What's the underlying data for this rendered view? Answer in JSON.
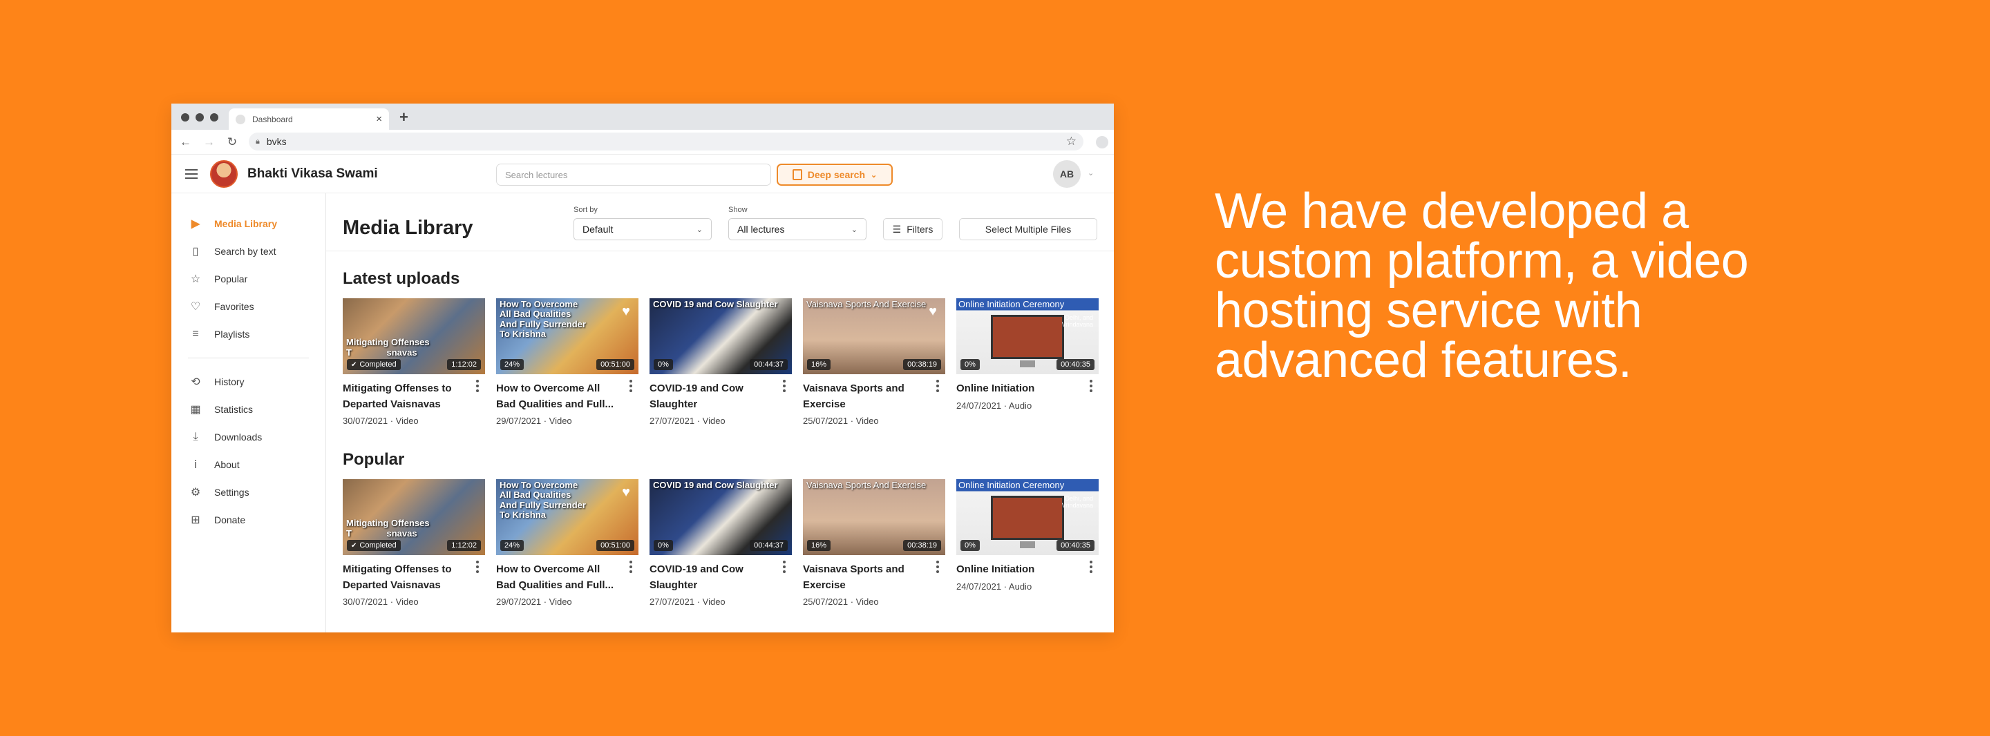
{
  "browser": {
    "tab_title": "Dashboard",
    "url": "bvks"
  },
  "header": {
    "brand": "Bhakti Vikasa Swami",
    "search_placeholder": "Search lectures",
    "deep_search_label": "Deep search",
    "user_initials": "AB"
  },
  "sidebar": {
    "items": [
      {
        "label": "Media Library",
        "icon": "media-library-icon",
        "active": true
      },
      {
        "label": "Search by text",
        "icon": "search-text-icon"
      },
      {
        "label": "Popular",
        "icon": "star-icon"
      },
      {
        "label": "Favorites",
        "icon": "heart-icon"
      },
      {
        "label": "Playlists",
        "icon": "playlist-icon"
      },
      {
        "label": "History",
        "icon": "history-icon"
      },
      {
        "label": "Statistics",
        "icon": "statistics-icon"
      },
      {
        "label": "Downloads",
        "icon": "download-icon"
      },
      {
        "label": "About",
        "icon": "info-icon"
      },
      {
        "label": "Settings",
        "icon": "gear-icon"
      },
      {
        "label": "Donate",
        "icon": "gift-icon"
      }
    ]
  },
  "main": {
    "title": "Media Library",
    "sort_by_label": "Sort by",
    "sort_by_value": "Default",
    "show_label": "Show",
    "show_value": "All lectures",
    "filters_label": "Filters",
    "select_multiple_label": "Select Multiple Files"
  },
  "sections": [
    {
      "title": "Latest uploads",
      "cards": [
        {
          "thumb_text": "",
          "thumb_text2": "Mitigating Offenses\nT              snavas",
          "badge": "Completed",
          "duration": "1:12:02",
          "title": "Mitigating Offenses to Departed Vaisnavas",
          "date": "30/07/2021",
          "type": "Video",
          "heart": false
        },
        {
          "thumb_text": "How To Overcome\nAll Bad Qualities\nAnd Fully Surrender\nTo Krishna",
          "thumb_text2": "",
          "badge": "24%",
          "duration": "00:51:00",
          "title": "How to Overcome All Bad Qualities and Full...",
          "date": "29/07/2021",
          "type": "Video",
          "heart": true
        },
        {
          "thumb_text": "COVID 19 and Cow Slaughter",
          "thumb_text2": "",
          "badge": "0%",
          "duration": "00:44:37",
          "title": "COVID-19 and Cow Slaughter",
          "date": "27/07/2021",
          "type": "Video",
          "heart": false
        },
        {
          "thumb_text": "Vaisnava Sports And Exercise",
          "thumb_text2": "",
          "badge": "16%",
          "duration": "00:38:19",
          "title": "Vaisnava Sports and Exercise",
          "date": "25/07/2021",
          "type": "Video",
          "heart": true
        },
        {
          "thumb_text": "Online Initiation Ceremony",
          "thumb_text2": "Delhi, and\nVrindavana",
          "badge": "0%",
          "duration": "00:40:35",
          "title": "Online Initiation",
          "date": "24/07/2021",
          "type": "Audio",
          "heart": false
        }
      ]
    },
    {
      "title": "Popular",
      "cards": [
        {
          "thumb_text": "",
          "thumb_text2": "Mitigating Offenses\nT              snavas",
          "badge": "Completed",
          "duration": "1:12:02",
          "title": "Mitigating Offenses to Departed Vaisnavas",
          "date": "30/07/2021",
          "type": "Video",
          "heart": false
        },
        {
          "thumb_text": "How To Overcome\nAll Bad Qualities\nAnd Fully Surrender\nTo Krishna",
          "thumb_text2": "",
          "badge": "24%",
          "duration": "00:51:00",
          "title": "How to Overcome All Bad Qualities and Full...",
          "date": "29/07/2021",
          "type": "Video",
          "heart": true
        },
        {
          "thumb_text": "COVID 19 and Cow Slaughter",
          "thumb_text2": "",
          "badge": "0%",
          "duration": "00:44:37",
          "title": "COVID-19 and Cow Slaughter",
          "date": "27/07/2021",
          "type": "Video",
          "heart": false
        },
        {
          "thumb_text": "Vaisnava Sports And Exercise",
          "thumb_text2": "",
          "badge": "16%",
          "duration": "00:38:19",
          "title": "Vaisnava Sports and Exercise",
          "date": "25/07/2021",
          "type": "Video",
          "heart": false
        },
        {
          "thumb_text": "Online Initiation Ceremony",
          "thumb_text2": "Delhi, and\nVrindavana",
          "badge": "0%",
          "duration": "00:40:35",
          "title": "Online Initiation",
          "date": "24/07/2021",
          "type": "Audio",
          "heart": false
        }
      ]
    }
  ],
  "tagline": "We have developed a custom platform, a video hosting service with advanced features.",
  "colors": {
    "background": "#FE8418",
    "accent": "#EE8A2A"
  }
}
